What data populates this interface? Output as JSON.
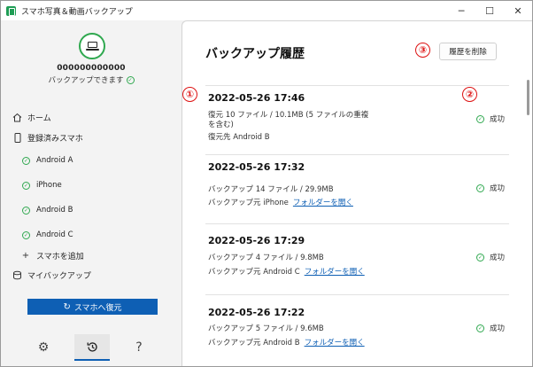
{
  "window": {
    "title": "スマホ写真＆動画バックアップ",
    "controls": [
      "─",
      "☐",
      "✕"
    ]
  },
  "sidebar": {
    "device_id": "000000000000",
    "device_status": "バックアップできます",
    "home_label": "ホーム",
    "registered_label": "登録済みスマホ",
    "devices": [
      {
        "label": "Android A"
      },
      {
        "label": "iPhone"
      },
      {
        "label": "Android B"
      },
      {
        "label": "Android C"
      }
    ],
    "add_device_label": "スマホを追加",
    "my_backup_label": "マイバックアップ",
    "restore_label": "スマホへ復元",
    "bottom_icons": [
      "gear-icon",
      "history-icon",
      "help-icon"
    ],
    "accent_color": "#0e5fb4",
    "ok_color": "#2fa84f"
  },
  "main": {
    "title": "バックアップ履歴",
    "delete_label": "履歴を削除",
    "annotations": [
      "①",
      "②",
      "③"
    ],
    "entries": [
      {
        "date": "2022-05-26 17:46",
        "line1": "復元 10 ファイル / 10.1MB (5 ファイルの重複",
        "line2": "を含む)",
        "line3": "復元先 Android B",
        "link": "",
        "result": "成功"
      },
      {
        "date": "2022-05-26 17:32",
        "line1": "バックアップ 14 ファイル / 29.9MB",
        "line2": "バックアップ元 iPhone",
        "link": "フォルダーを開く",
        "result": "成功"
      },
      {
        "date": "2022-05-26 17:29",
        "line1": "バックアップ 4 ファイル / 9.8MB",
        "line2": "バックアップ元 Android C",
        "link": "フォルダーを開く",
        "result": "成功"
      },
      {
        "date": "2022-05-26 17:22",
        "line1": "バックアップ 5 ファイル / 9.6MB",
        "line2": "バックアップ元 Android B",
        "link": "フォルダーを開く",
        "result": "成功"
      }
    ]
  }
}
